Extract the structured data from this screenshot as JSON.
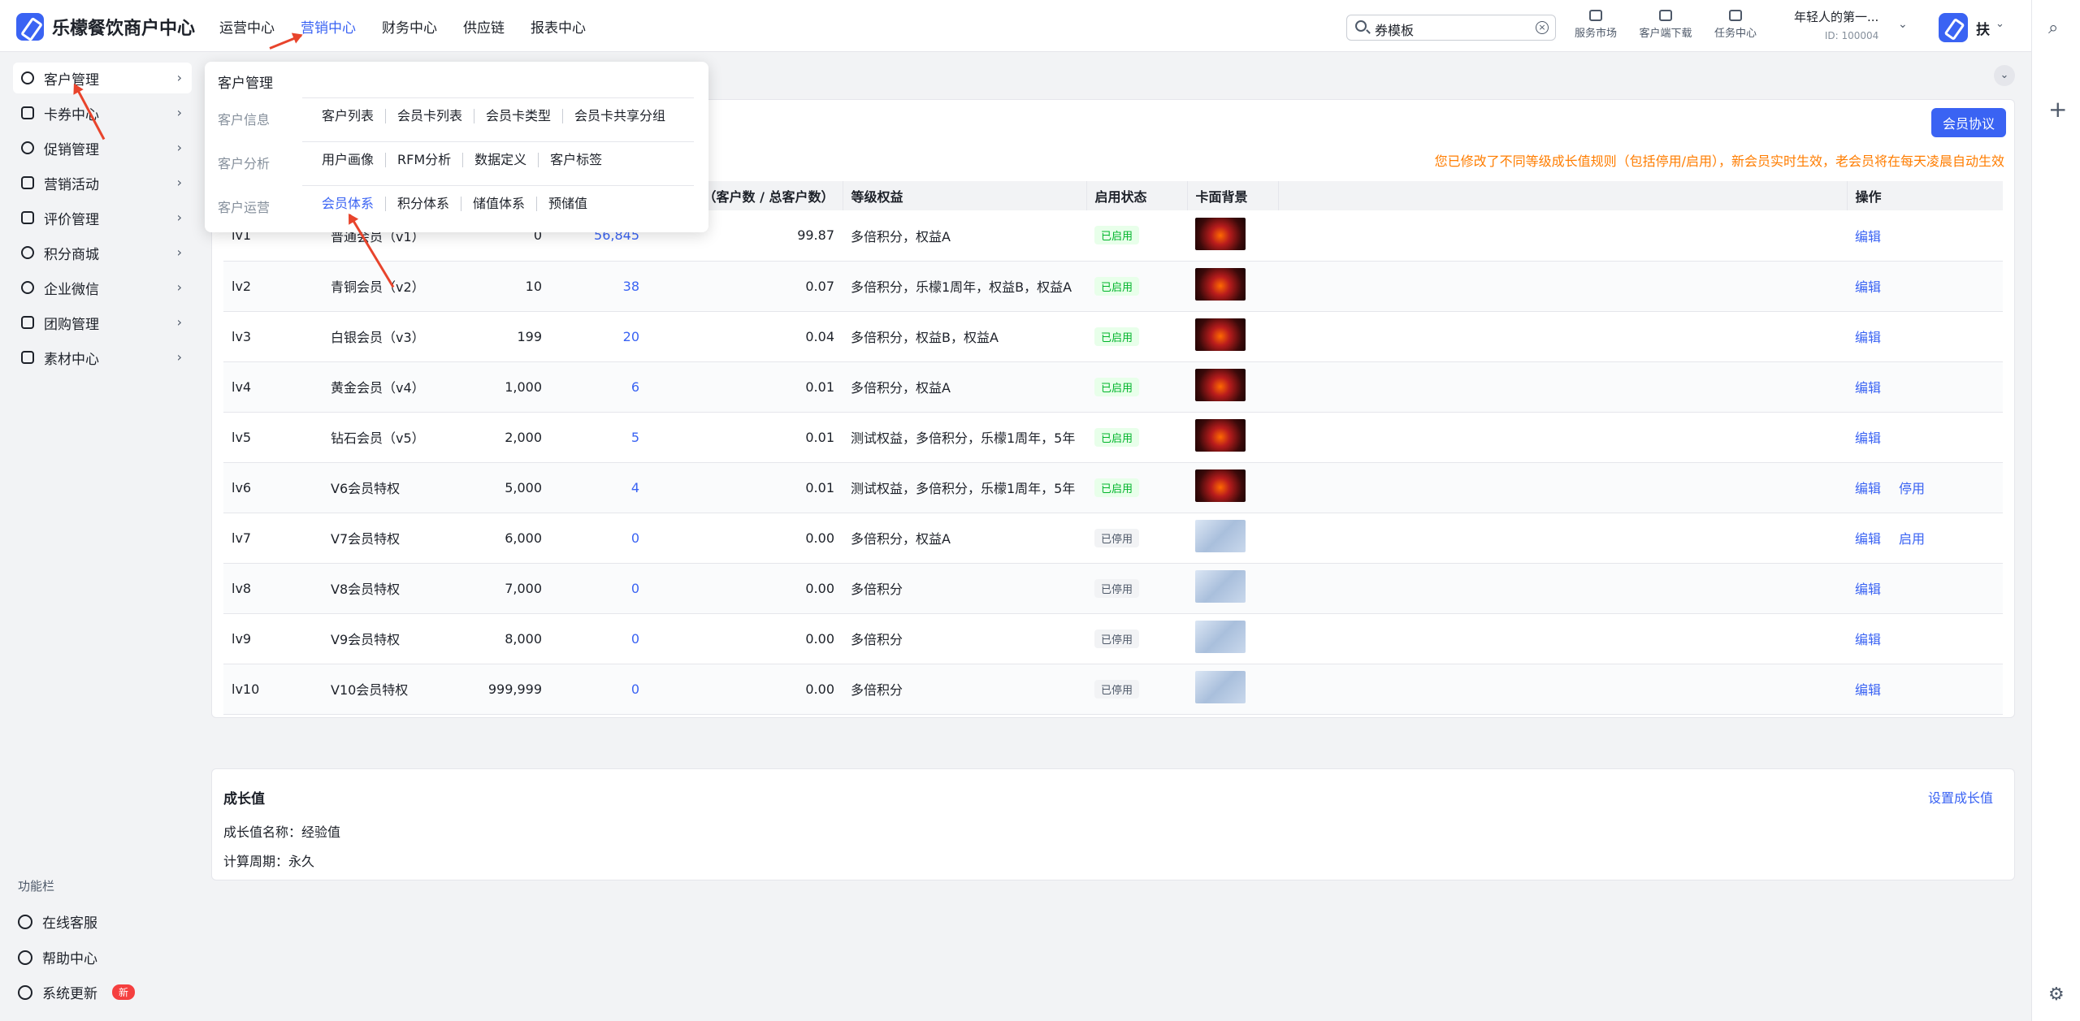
{
  "header": {
    "logo_text": "乐檬餐饮商户中心",
    "nav": [
      "运营中心",
      "营销中心",
      "财务中心",
      "供应链",
      "报表中心"
    ],
    "search_value": "券模板",
    "tools": [
      "服务市场",
      "客户端下载",
      "任务中心"
    ],
    "user_name": "年轻人的第一...",
    "user_id": "ID: 100004",
    "avatar_name": "扶"
  },
  "sidebar": {
    "items": [
      "客户管理",
      "卡券中心",
      "促销管理",
      "营销活动",
      "评价管理",
      "积分商城",
      "企业微信",
      "团购管理",
      "素材中心"
    ],
    "func_title": "功能栏",
    "func_items": [
      "在线客服",
      "帮助中心",
      "系统更新"
    ],
    "new_badge": "新"
  },
  "dropdown": {
    "title": "客户管理",
    "rows": [
      {
        "category": "客户信息",
        "links": [
          "客户列表",
          "会员卡列表",
          "会员卡类型",
          "会员卡共享分组"
        ]
      },
      {
        "category": "客户分析",
        "links": [
          "用户画像",
          "RFM分析",
          "数据定义",
          "客户标签"
        ]
      },
      {
        "category": "客户运营",
        "links": [
          "会员体系",
          "积分体系",
          "储值体系",
          "预储值"
        ]
      }
    ]
  },
  "main": {
    "agree_button": "会员协议",
    "notice": "您已修改了不同等级成长值规则（包括停用/启用），新会员实时生效，老会员将在每天凌晨自动生效",
    "columns": [
      "",
      "",
      "",
      "",
      "率（客户数 / 总客户数）",
      "等级权益",
      "启用状态",
      "卡面背景",
      "",
      "操作"
    ],
    "rows": [
      {
        "level": "lv1",
        "name": "普通会员（v1）",
        "growth": "0",
        "count": "56,845",
        "ratio": "99.87",
        "rights": "多倍积分，权益A",
        "status": "已启用",
        "bg": "red",
        "ops": [
          "编辑"
        ]
      },
      {
        "level": "lv2",
        "name": "青铜会员（v2）",
        "growth": "10",
        "count": "38",
        "ratio": "0.07",
        "rights": "多倍积分，乐檬1周年，权益B，权益A",
        "status": "已启用",
        "bg": "red",
        "ops": [
          "编辑"
        ]
      },
      {
        "level": "lv3",
        "name": "白银会员（v3）",
        "growth": "199",
        "count": "20",
        "ratio": "0.04",
        "rights": "多倍积分，权益B，权益A",
        "status": "已启用",
        "bg": "red",
        "ops": [
          "编辑"
        ]
      },
      {
        "level": "lv4",
        "name": "黄金会员（v4）",
        "growth": "1,000",
        "count": "6",
        "ratio": "0.01",
        "rights": "多倍积分，权益A",
        "status": "已启用",
        "bg": "red",
        "ops": [
          "编辑"
        ]
      },
      {
        "level": "lv5",
        "name": "钻石会员（v5）",
        "growth": "2,000",
        "count": "5",
        "ratio": "0.01",
        "rights": "测试权益，多倍积分，乐檬1周年，5年",
        "status": "已启用",
        "bg": "red",
        "ops": [
          "编辑"
        ]
      },
      {
        "level": "lv6",
        "name": "V6会员特权",
        "growth": "5,000",
        "count": "4",
        "ratio": "0.01",
        "rights": "测试权益，多倍积分，乐檬1周年，5年",
        "status": "已启用",
        "bg": "red",
        "ops": [
          "编辑",
          "停用"
        ]
      },
      {
        "level": "lv7",
        "name": "V7会员特权",
        "growth": "6,000",
        "count": "0",
        "ratio": "0.00",
        "rights": "多倍积分，权益A",
        "status": "已停用",
        "bg": "blue",
        "ops": [
          "编辑",
          "启用"
        ]
      },
      {
        "level": "lv8",
        "name": "V8会员特权",
        "growth": "7,000",
        "count": "0",
        "ratio": "0.00",
        "rights": "多倍积分",
        "status": "已停用",
        "bg": "blue",
        "ops": [
          "编辑"
        ]
      },
      {
        "level": "lv9",
        "name": "V9会员特权",
        "growth": "8,000",
        "count": "0",
        "ratio": "0.00",
        "rights": "多倍积分",
        "status": "已停用",
        "bg": "blue",
        "ops": [
          "编辑"
        ]
      },
      {
        "level": "lv10",
        "name": "V10会员特权",
        "growth": "999,999",
        "count": "0",
        "ratio": "0.00",
        "rights": "多倍积分",
        "status": "已停用",
        "bg": "blue",
        "ops": [
          "编辑"
        ]
      }
    ]
  },
  "growth": {
    "title": "成长值",
    "set_link": "设置成长值",
    "name_line": "成长值名称：经验值",
    "period_line": "计算周期：永久"
  },
  "colors": {
    "accent": "#3a63f3",
    "notice": "#ff7d00",
    "annotation_arrow": "#e8442c"
  }
}
